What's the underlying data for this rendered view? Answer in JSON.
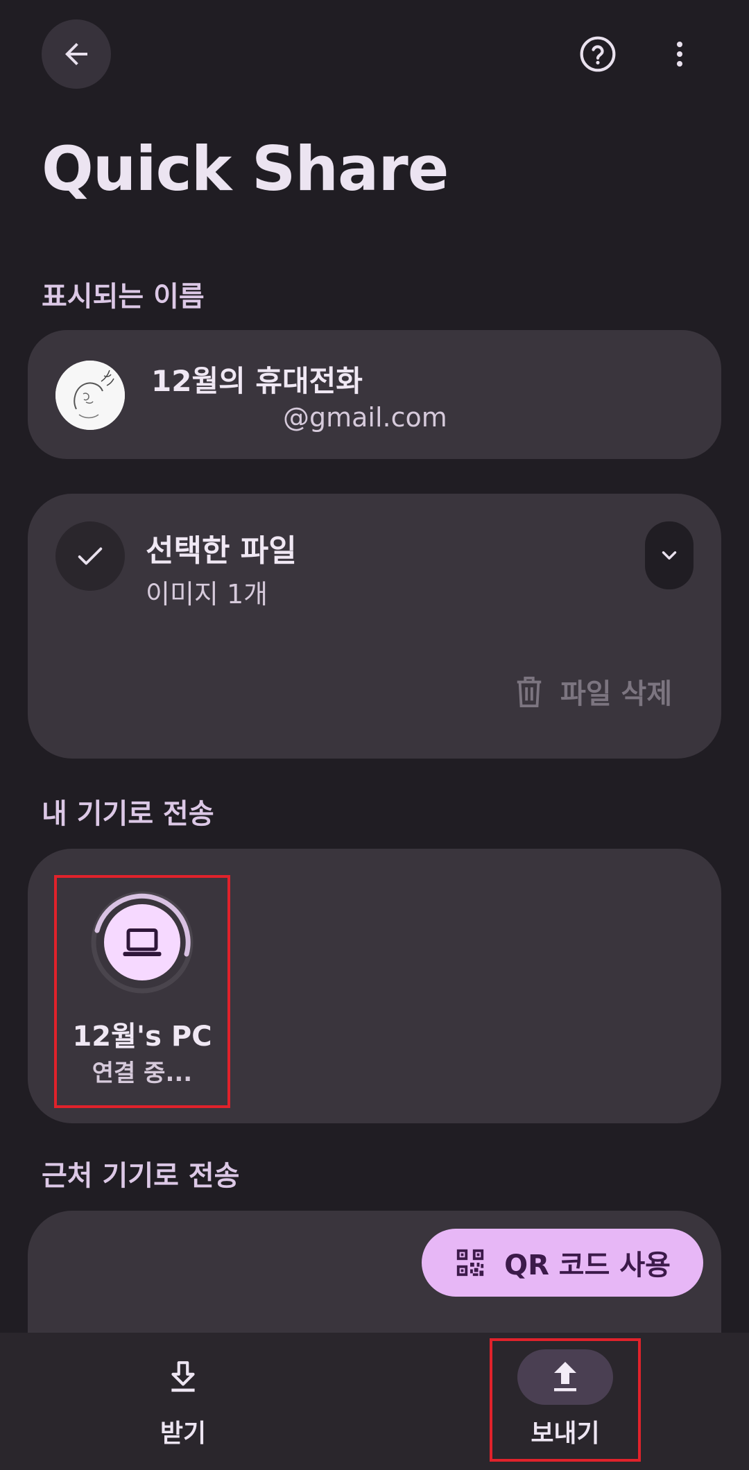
{
  "app": {
    "title": "Quick Share"
  },
  "icons": {
    "back": "back-arrow-icon",
    "help": "help-icon",
    "more": "more-vert-icon",
    "check": "check-icon",
    "expand": "chevron-down-icon",
    "delete": "trash-icon",
    "laptop": "laptop-icon",
    "qr": "qr-code-icon",
    "receive": "download-icon",
    "send": "upload-icon"
  },
  "colors": {
    "background": "#201d23",
    "card": "#3a353d",
    "accent": "#e7b7f6",
    "highlight": "#e0222b"
  },
  "display_name": {
    "section_label": "표시되는 이름",
    "name": "12월의 휴대전화",
    "email": "@gmail.com"
  },
  "selected_files": {
    "title": "선택한 파일",
    "subtitle": "이미지 1개",
    "delete_label": "파일 삭제"
  },
  "my_devices": {
    "section_label": "내 기기로 전송",
    "device_name": "12월's PC",
    "device_status": "연결 중..."
  },
  "nearby": {
    "section_label": "근처 기기로 전송",
    "qr_label": "QR 코드 사용"
  },
  "bottom_nav": {
    "receive_label": "받기",
    "send_label": "보내기"
  }
}
